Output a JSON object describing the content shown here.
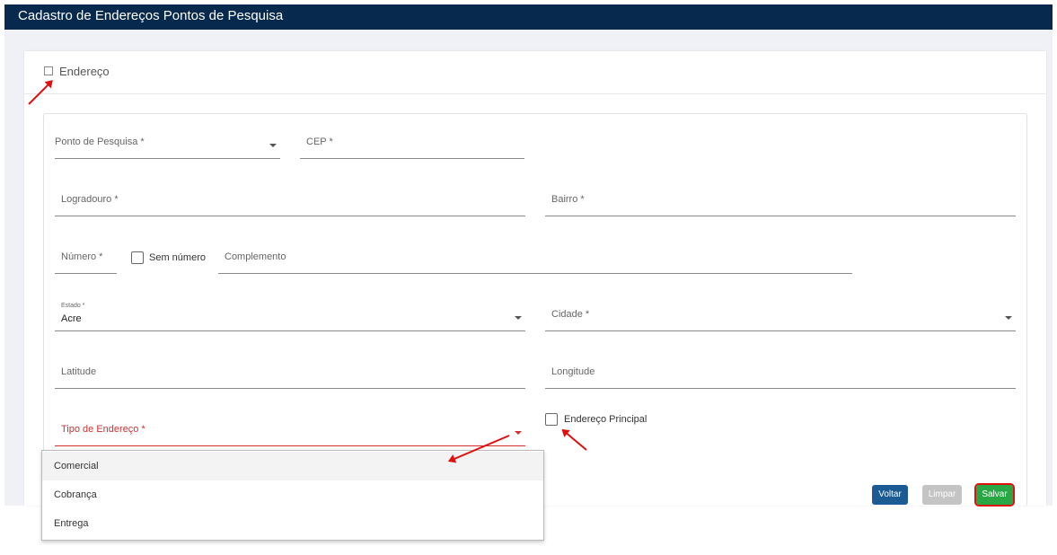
{
  "header": {
    "title": "Cadastro de Endereços Pontos de Pesquisa"
  },
  "card": {
    "title": "Endereço",
    "icon": "edit-icon"
  },
  "form": {
    "ponto_pesquisa": {
      "label": "Ponto de Pesquisa *"
    },
    "cep": {
      "label": "CEP *"
    },
    "logradouro": {
      "label": "Logradouro *"
    },
    "bairro": {
      "label": "Bairro *"
    },
    "numero": {
      "label": "Número *"
    },
    "sem_numero": {
      "label": "Sem número",
      "checked": false
    },
    "complemento": {
      "label": "Complemento"
    },
    "estado": {
      "label": "Estado *",
      "value": "Acre"
    },
    "cidade": {
      "label": "Cidade *"
    },
    "latitude": {
      "label": "Latitude"
    },
    "longitude": {
      "label": "Longitude"
    },
    "tipo_endereco": {
      "label": "Tipo de Endereço *",
      "options": [
        "Comercial",
        "Cobrança",
        "Entrega"
      ]
    },
    "endereco_principal": {
      "label": "Endereço Principal",
      "checked": false
    }
  },
  "buttons": {
    "voltar": "Voltar",
    "limpar": "Limpar",
    "salvar": "Salvar"
  },
  "colors": {
    "header": "#06294d",
    "voltar": "#1b5a93",
    "limpar": "#c4c4c4",
    "salvar": "#28a745",
    "error": "#d32f2f",
    "annotation": "#e01010"
  }
}
